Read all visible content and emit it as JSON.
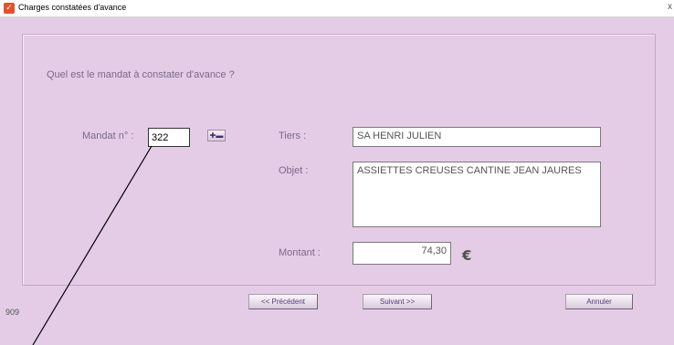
{
  "window": {
    "title": "Charges constatées d'avance",
    "close_glyph": "x"
  },
  "question": "Quel est le mandat à constater d'avance ?",
  "mandat": {
    "label": "Mandat n° :",
    "value": "322"
  },
  "tiers": {
    "label": "Tiers :",
    "value": "SA HENRI JULIEN"
  },
  "objet": {
    "label": "Objet :",
    "value": "ASSIETTES CREUSES CANTINE JEAN JAURES"
  },
  "montant": {
    "label": "Montant :",
    "value": "74,30",
    "currency": "€"
  },
  "buttons": {
    "previous": "<< Précédent",
    "next": "Suivant >>",
    "cancel": "Annuler"
  },
  "footer": {
    "number": "909"
  },
  "icons": {
    "app": "app-logo-icon",
    "picker": "lookup-icon"
  },
  "colors": {
    "background": "#e4cce6",
    "label": "#7a6a8a",
    "button_text": "#5a3a7a"
  }
}
